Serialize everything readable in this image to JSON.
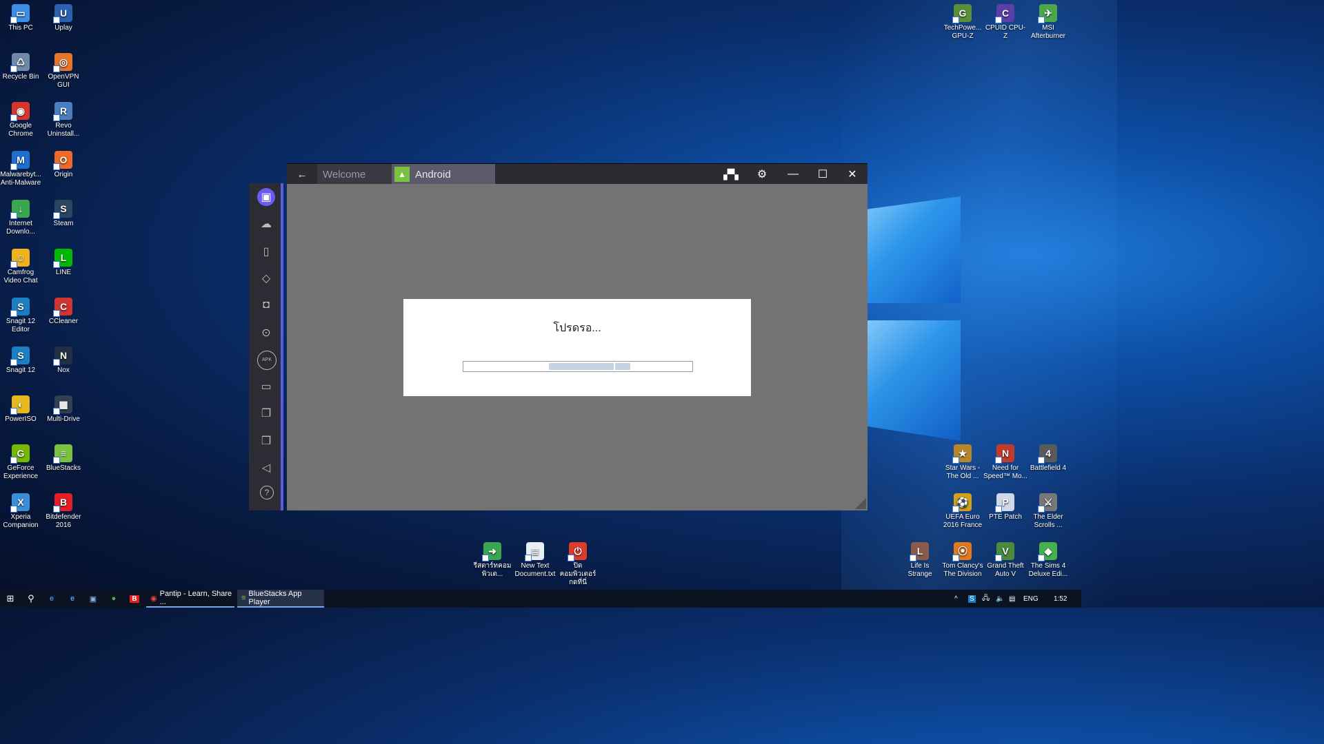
{
  "desktop_icons_left": [
    {
      "label": "This PC",
      "icon": "this-pc-icon",
      "color": "#3a8ee6",
      "glyph": "▭"
    },
    {
      "label": "Uplay",
      "icon": "uplay-icon",
      "color": "#2b5fb0",
      "glyph": "U"
    },
    {
      "label": "Recycle Bin",
      "icon": "recycle-bin-icon",
      "color": "#6f8aa8",
      "glyph": "♺"
    },
    {
      "label": "OpenVPN GUI",
      "icon": "openvpn-icon",
      "color": "#e8742a",
      "glyph": "◎"
    },
    {
      "label": "Google Chrome",
      "icon": "chrome-icon",
      "color": "#d9342b",
      "glyph": "◉"
    },
    {
      "label": "Revo Uninstall...",
      "icon": "revo-uninstaller-icon",
      "color": "#4a7fc1",
      "glyph": "R"
    },
    {
      "label": "Malwarebyt... Anti-Malware",
      "icon": "malwarebytes-icon",
      "color": "#1f6fd1",
      "glyph": "M"
    },
    {
      "label": "Origin",
      "icon": "origin-icon",
      "color": "#f06a25",
      "glyph": "O"
    },
    {
      "label": "Internet Downlo...",
      "icon": "idm-icon",
      "color": "#3aa64f",
      "glyph": "↓"
    },
    {
      "label": "Steam",
      "icon": "steam-icon",
      "color": "#2a475e",
      "glyph": "S"
    },
    {
      "label": "Camfrog Video Chat",
      "icon": "camfrog-icon",
      "color": "#f2b21b",
      "glyph": "☺"
    },
    {
      "label": "LINE",
      "icon": "line-icon",
      "color": "#00b900",
      "glyph": "L"
    },
    {
      "label": "Snagit 12 Editor",
      "icon": "snagit-editor-icon",
      "color": "#1c7fc4",
      "glyph": "S"
    },
    {
      "label": "CCleaner",
      "icon": "ccleaner-icon",
      "color": "#d03530",
      "glyph": "C"
    },
    {
      "label": "Snagit 12",
      "icon": "snagit-icon",
      "color": "#1c7fc4",
      "glyph": "S"
    },
    {
      "label": "Nox",
      "icon": "nox-icon",
      "color": "#203040",
      "glyph": "N"
    },
    {
      "label": "PowerISO",
      "icon": "poweriso-icon",
      "color": "#e6b820",
      "glyph": "◐"
    },
    {
      "label": "Multi-Drive",
      "icon": "multi-drive-icon",
      "color": "#304050",
      "glyph": "▦"
    },
    {
      "label": "GeForce Experience",
      "icon": "geforce-icon",
      "color": "#76b900",
      "glyph": "G"
    },
    {
      "label": "BlueStacks",
      "icon": "bluestacks-icon",
      "color": "#7cc242",
      "glyph": "≡"
    },
    {
      "label": "Xperia Companion",
      "icon": "xperia-icon",
      "color": "#3b8ed8",
      "glyph": "X"
    },
    {
      "label": "Bitdefender 2016",
      "icon": "bitdefender-icon",
      "color": "#e21f26",
      "glyph": "B"
    }
  ],
  "desktop_icons_right_top": [
    {
      "label": "TechPowe... GPU-Z",
      "icon": "gpu-z-icon",
      "color": "#5a8f3a",
      "glyph": "G"
    },
    {
      "label": "CPUID CPU-Z",
      "icon": "cpu-z-icon",
      "color": "#5b3fa8",
      "glyph": "C"
    },
    {
      "label": "MSI Afterburner",
      "icon": "msi-afterburner-icon",
      "color": "#4aa84a",
      "glyph": "✈"
    }
  ],
  "desktop_icons_right_bottom": [
    {
      "label": "Star Wars - The Old ...",
      "icon": "star-wars-icon",
      "color": "#b8862a",
      "glyph": "★"
    },
    {
      "label": "Need for Speed™ Mo...",
      "icon": "nfs-icon",
      "color": "#c23a2a",
      "glyph": "N"
    },
    {
      "label": "Battlefield 4",
      "icon": "battlefield-icon",
      "color": "#5a5a5a",
      "glyph": "4"
    },
    {
      "label": "UEFA Euro 2016 France",
      "icon": "uefa-euro-icon",
      "color": "#d4a017",
      "glyph": "⚽"
    },
    {
      "label": "PTE Patch",
      "icon": "pte-patch-icon",
      "color": "#d0d8e8",
      "glyph": "P"
    },
    {
      "label": "The Elder Scrolls ...",
      "icon": "elder-scrolls-icon",
      "color": "#777777",
      "glyph": "⚔"
    },
    {
      "label": "Life Is Strange",
      "icon": "life-is-strange-icon",
      "color": "#8a5a4a",
      "glyph": "L"
    },
    {
      "label": "Tom Clancy's The Division",
      "icon": "division-icon",
      "color": "#e07a1a",
      "glyph": "⦿"
    },
    {
      "label": "Grand Theft Auto V",
      "icon": "gta-v-icon",
      "color": "#4a8a3a",
      "glyph": "V"
    },
    {
      "label": "The Sims 4 Deluxe Edi...",
      "icon": "sims-icon",
      "color": "#46b04a",
      "glyph": "◆"
    }
  ],
  "desktop_icons_center": [
    {
      "label": "รีสตาร์ทคอมพิวเต...",
      "icon": "restart-shortcut-icon",
      "color": "#3aa64f",
      "glyph": "➜"
    },
    {
      "label": "New Text Document.txt",
      "icon": "text-document-icon",
      "color": "#e8eef5",
      "glyph": "≣"
    },
    {
      "label": "ปิดคอมพิวเตอร์กดที่นี่",
      "icon": "shutdown-shortcut-icon",
      "color": "#e03a2a",
      "glyph": "⏻"
    }
  ],
  "bluestacks": {
    "tabs": [
      {
        "label": "Welcome",
        "active": false
      },
      {
        "label": "Android",
        "active": true
      }
    ],
    "back_icon": "←",
    "sidebar": [
      {
        "name": "video-call-icon",
        "glyph": "▣",
        "active": true
      },
      {
        "name": "chat-icon",
        "glyph": "☁",
        "active": false
      },
      {
        "name": "multi-instance-icon",
        "glyph": "▯",
        "active": false
      },
      {
        "name": "rotate-icon",
        "glyph": "◇",
        "active": false
      },
      {
        "name": "camera-icon",
        "glyph": "◘",
        "active": false
      },
      {
        "name": "location-icon",
        "glyph": "⊙",
        "active": false
      },
      {
        "name": "apk-install-icon",
        "glyph": "APK",
        "active": false
      },
      {
        "name": "folder-icon",
        "glyph": "▭",
        "active": false
      },
      {
        "name": "copy-icon",
        "glyph": "❐",
        "active": false
      },
      {
        "name": "paste-icon",
        "glyph": "❒",
        "active": false
      },
      {
        "name": "volume-icon",
        "glyph": "◁",
        "active": false
      },
      {
        "name": "help-icon",
        "glyph": "?",
        "active": false
      }
    ],
    "dialog": {
      "message": "โปรดรอ...",
      "progress_indeterminate": true
    }
  },
  "taskbar": {
    "apps": [
      {
        "label": "Pantip - Learn, Share ...",
        "icon": "chrome-icon"
      },
      {
        "label": "BlueStacks App Player",
        "icon": "bluestacks-icon"
      }
    ],
    "language": "ENG",
    "time": "1:52"
  }
}
